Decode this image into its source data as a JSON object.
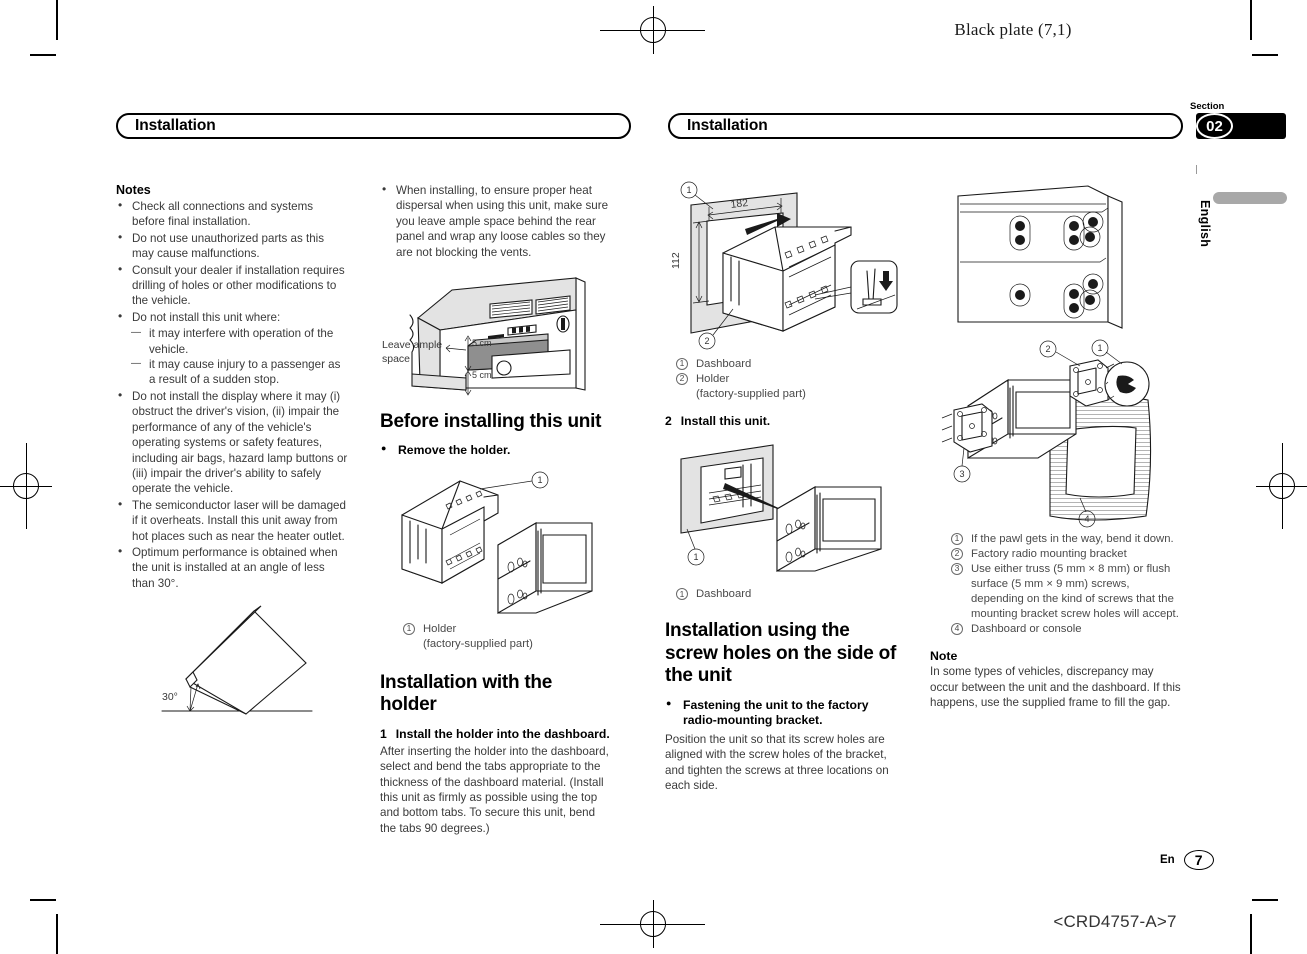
{
  "print": {
    "plate_label": "Black plate (7,1)",
    "doc_code": "<CRD4757-A>7"
  },
  "header": {
    "left_title": "Installation",
    "right_title": "Installation",
    "section_label": "Section",
    "section_number": "02",
    "language_tab": "English"
  },
  "footer": {
    "lang_code": "En",
    "page_number": "7"
  },
  "col1": {
    "notes_title": "Notes",
    "notes": [
      "Check all connections and systems before final installation.",
      "Do not use unauthorized parts as this may cause malfunctions.",
      "Consult your dealer if installation requires drilling of holes or other modifications to the vehicle.",
      "Do not install this unit where:",
      "Do not install the display where it may (i) obstruct the driver's vision, (ii) impair the performance of any of the vehicle's operating systems or safety features, including air bags, hazard lamp buttons or (iii) impair the driver's ability to safely operate the vehicle.",
      "The semiconductor laser will be damaged if it overheats. Install this unit away from hot places such as near the heater outlet.",
      "Optimum performance is obtained when the unit is installed at an angle of less than 30°."
    ],
    "sub_notes": [
      "it may interfere with operation of the vehicle.",
      "it may cause injury to a passenger as a result of a sudden stop."
    ],
    "angle_figure": {
      "angle_label": "30°"
    }
  },
  "col2": {
    "heat_note": "When installing, to ensure proper heat dispersal when using this unit, make sure you leave ample space behind the rear panel and wrap any loose cables so they are not blocking the vents.",
    "dash_figure": {
      "leave_label_line1": "Leave ample",
      "leave_label_line2": "space",
      "dim_top": "5 cm",
      "dim_bottom": "5 cm"
    },
    "before_heading": "Before installing this unit",
    "remove_holder": "Remove the holder.",
    "holder_callouts": [
      {
        "num": "1",
        "text": "Holder",
        "sub": "(factory-supplied part)"
      }
    ],
    "install_holder_heading": "Installation with the holder",
    "step1_num": "1",
    "step1_title": "Install the holder into the dashboard.",
    "step1_body": "After inserting the holder into the dashboard, select and bend the tabs appropriate to the thickness of the dashboard material. (Install this unit as firmly as possible using the top and bottom tabs. To secure this unit, bend the tabs 90 degrees.)"
  },
  "col3": {
    "dash_holder_figure": {
      "dim_width": "182",
      "dim_height": "112",
      "callout_1": "1",
      "callout_2": "2"
    },
    "callouts_1": [
      {
        "num": "1",
        "text": "Dashboard",
        "sub": ""
      },
      {
        "num": "2",
        "text": "Holder",
        "sub": "(factory-supplied part)"
      }
    ],
    "step2_num": "2",
    "step2_title": "Install this unit.",
    "callouts_2": [
      {
        "num": "1",
        "text": "Dashboard",
        "sub": ""
      }
    ],
    "screw_heading": "Installation using the screw holes on the side of the unit",
    "fasten_title": "Fastening the unit to the factory radio-mounting bracket.",
    "fasten_body": "Position the unit so that its screw holes are aligned with the screw holes of the bracket, and tighten the screws at three locations on each side."
  },
  "col4": {
    "callouts": [
      {
        "num": "1",
        "text": "If the pawl gets in the way, bend it down.",
        "sub": ""
      },
      {
        "num": "2",
        "text": "Factory radio mounting bracket",
        "sub": ""
      },
      {
        "num": "3",
        "text": "Use either truss (5 mm × 8 mm) or flush surface (5 mm × 9 mm) screws, depending on the kind of screws that the mounting bracket screw holes will accept.",
        "sub": ""
      },
      {
        "num": "4",
        "text": "Dashboard or console",
        "sub": ""
      }
    ],
    "note_title": "Note",
    "note_body": "In some types of vehicles, discrepancy may occur between the unit and the dashboard. If this happens, use the supplied frame to fill the gap.",
    "bracket_figure": {
      "callout_1": "1",
      "callout_2": "2",
      "callout_3": "3",
      "callout_4": "4"
    }
  },
  "colors": {
    "text": "#3a3a3a",
    "heading": "#000000",
    "section_bg": "#000000",
    "lang_tab": "#a8a8a8"
  }
}
